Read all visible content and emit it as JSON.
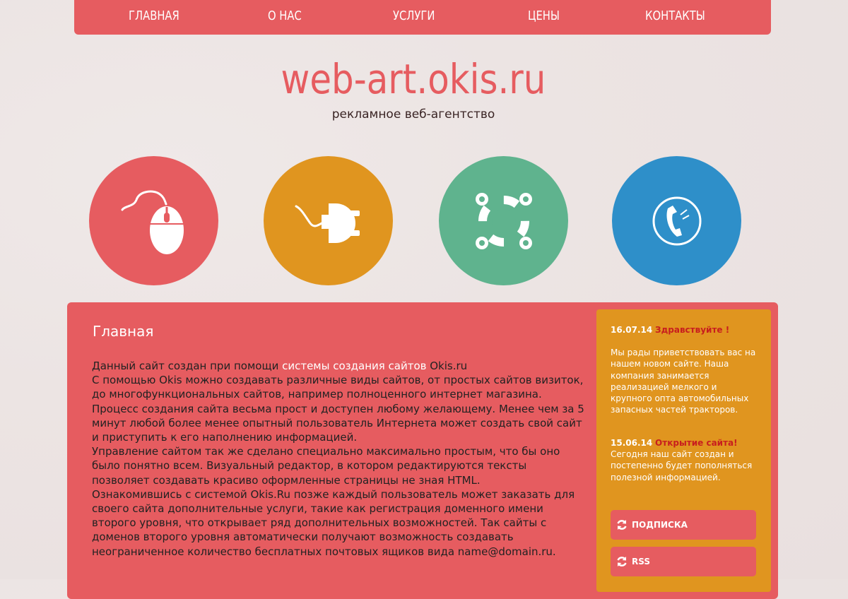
{
  "nav": [
    "ГЛАВНАЯ",
    "О НАС",
    "УСЛУГИ",
    "ЦЕНЫ",
    "КОНТАКТЫ"
  ],
  "brand": {
    "title": "web-art.okis.ru",
    "tagline": "рекламное веб-агентство"
  },
  "features": [
    {
      "icon": "mouse-icon",
      "color": "#e65c60"
    },
    {
      "icon": "plug-icon",
      "color": "#e0951f"
    },
    {
      "icon": "lifebuoy-icon",
      "color": "#5fb38e"
    },
    {
      "icon": "phone-icon",
      "color": "#2e8fc9"
    }
  ],
  "main": {
    "title": "Главная",
    "line1_pre": "Данный сайт создан при помощи ",
    "line1_link": "системы создания сайтов",
    "line1_post": " Okis.ru",
    "body": [
      "С помощью Okis можно создавать различные виды сайтов, от простых сайтов визиток, до многофункциональных сайтов, например полноценного интернет магазина.",
      "Процесс создания сайта весьма прост и доступен любому желающему. Менее чем за 5 минут любой более менее опытный пользователь Интернета может создать свой сайт и приступить к его наполнению информацией.",
      "Управление сайтом так же сделано специально максимально простым, что бы оно было понятно всем. Визуальный редактор, в котором редактируются тексты позволяет создавать красиво оформленные страницы не зная HTML.",
      "Ознакомившись с системой Okis.Ru позже каждый пользователь может заказать для своего сайта дополнительные услуги, такие как регистрация доменного имени второго уровня, что открывает ряд дополнительных возможностей. Так сайты с доменов второго уровня автоматически получают возможность создавать неограниченное количество бесплатных почтовых ящиков вида name@domain.ru."
    ]
  },
  "sidebar": {
    "news": [
      {
        "date": "16.07.14",
        "headline": "Здравствуйте !",
        "text": "Мы рады приветствовать вас на нашем новом сайте. Наша компания занимается реализацией мелкого и крупного опта автомобильных запасных частей тракторов."
      },
      {
        "date": "15.06.14",
        "headline": "Открытие сайта!",
        "text": "Сегодня наш сайт создан и постепенно будет пополняться полезной информацией."
      }
    ],
    "buttons": [
      {
        "label": "ПОДПИСКА",
        "icon": "refresh-icon"
      },
      {
        "label": "RSS",
        "icon": "refresh-icon"
      }
    ]
  }
}
